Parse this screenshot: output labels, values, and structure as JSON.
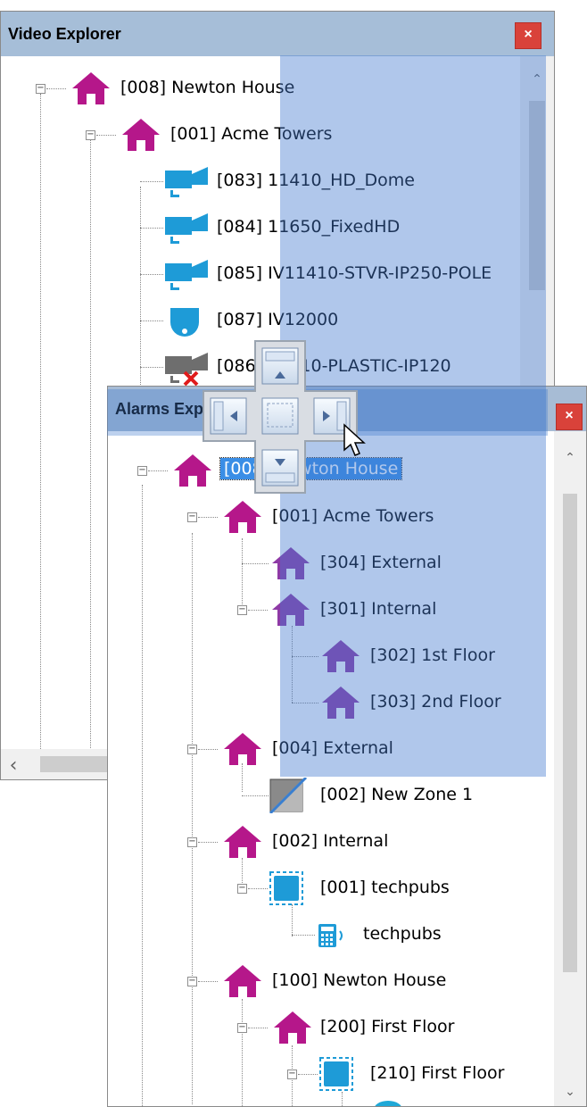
{
  "video_explorer": {
    "title": "Video Explorer",
    "close": "×",
    "root": "[008] Newton House",
    "site": "[001] Acme Towers",
    "cameras": [
      "[083] 11410_HD_Dome",
      "[084] 11650_FixedHD",
      "[085] IV11410-STVR-IP250-POLE",
      "[087] IV12000",
      "[086] 11410-PLASTIC-IP120"
    ],
    "scroll_left": "‹"
  },
  "alarms_explorer": {
    "title": "Alarms Explorer",
    "close": "×",
    "items": {
      "root": "[008] Newton House",
      "acme": "[001] Acme Towers",
      "ext304": "[304] External",
      "int301": "[301] Internal",
      "f302": "[302] 1st Floor",
      "f303": "[303] 2nd Floor",
      "ext004": "[004] External",
      "zone002": "[002] New Zone 1",
      "int002": "[002] Internal",
      "tp001": "[001] techpubs",
      "tp": "techpubs",
      "nh100": "[100] Newton House",
      "ff200": "[200] First Floor",
      "ff210": "[210] First Floor"
    }
  },
  "colors": {
    "house": "#b5178a",
    "house_sub": "#8e3aa6",
    "camera": "#1e9bd7",
    "dock_highlight": "#437acf",
    "titlebar": "#a6bed8",
    "close": "#d9423a"
  },
  "icons": [
    "house-icon",
    "camera-icon",
    "dome-camera-icon",
    "offline-camera-icon",
    "zone-icon",
    "area-icon",
    "keypad-icon",
    "dock-compass-icon",
    "mouse-pointer-icon"
  ]
}
